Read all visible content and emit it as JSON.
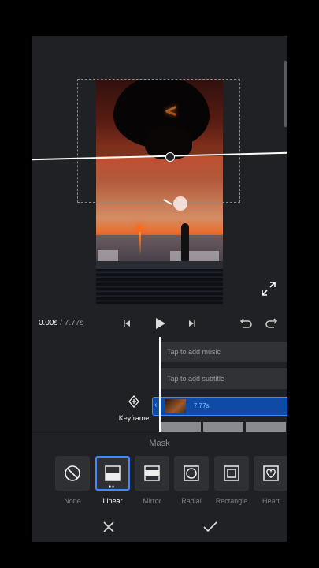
{
  "playback": {
    "current_time": "0.00s",
    "total_time": " / 7.77s"
  },
  "timeline": {
    "music_placeholder": "Tap to add music",
    "subtitle_placeholder": "Tap to add subtitle",
    "keyframe_label": "Keyframe",
    "clip_duration": "7.77s"
  },
  "mask_panel": {
    "title": "Mask",
    "options": [
      "None",
      "Linear",
      "Mirror",
      "Radial",
      "Rectangle",
      "Heart"
    ],
    "selected": "Linear"
  },
  "colors": {
    "accent": "#3b8cff",
    "clip_bg": "#0e4aa6",
    "panel_bg": "#202124"
  }
}
